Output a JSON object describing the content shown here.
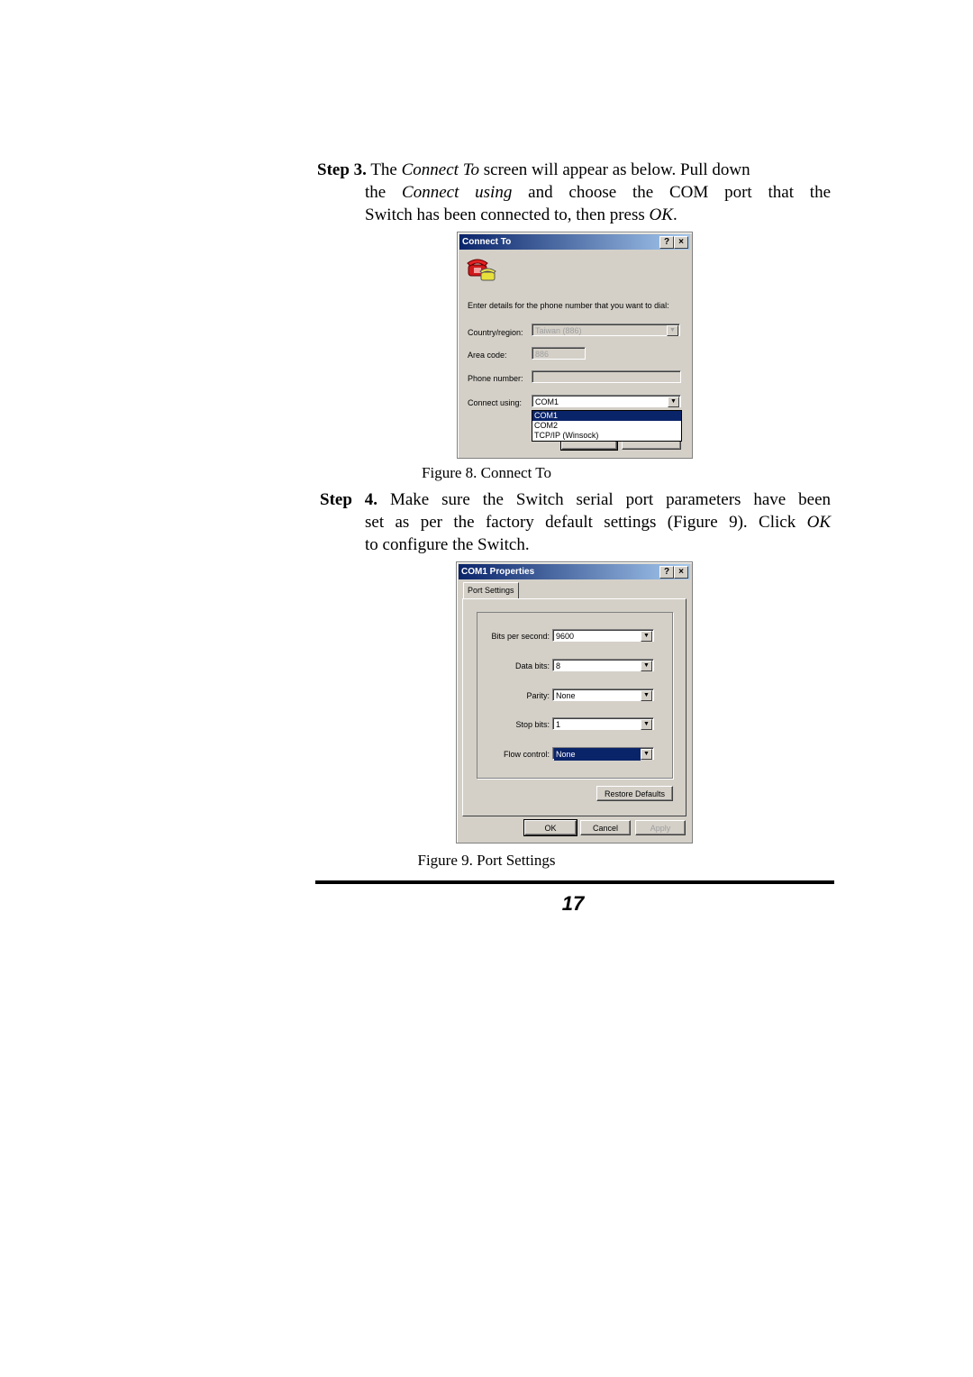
{
  "step3": {
    "label": "Step 3.",
    "line1_pre": "The ",
    "line1_em": "Connect To",
    "line1_post": " screen will appear as below. Pull down",
    "line2_pre": "the ",
    "line2_em": "Connect using",
    "line2_post": " and choose the COM port that the",
    "line3_pre": "Switch has been connected to, then press ",
    "line3_em": "OK",
    "line3_post": "."
  },
  "figure8": {
    "caption": "Figure 8. Connect To",
    "dialog": {
      "title": "Connect To",
      "help_button": "?",
      "close_button": "×",
      "icon": "telephone-icon",
      "prompt": "Enter details for the phone number that you want to dial:",
      "country_label": "Country/region:",
      "country_value": "Taiwan (886)",
      "area_label": "Area code:",
      "area_value": "886",
      "phone_label": "Phone number:",
      "phone_value": "",
      "connect_label": "Connect using:",
      "connect_value": "COM1",
      "connect_options": [
        "COM1",
        "COM2",
        "TCP/IP (Winsock)"
      ],
      "connect_selected": "COM1"
    }
  },
  "step4": {
    "label": "Step 4.",
    "line1": "Make sure the Switch serial port parameters have been",
    "line2_pre": "set as per the factory default settings (Figure 9). Click ",
    "line2_em": "OK",
    "line3": "to configure the Switch."
  },
  "figure9": {
    "caption": "Figure 9. Port Settings",
    "dialog": {
      "title": "COM1 Properties",
      "help_button": "?",
      "close_button": "×",
      "tab": "Port Settings",
      "fields": [
        {
          "label": "Bits per second:",
          "value": "9600"
        },
        {
          "label": "Data bits:",
          "value": "8"
        },
        {
          "label": "Parity:",
          "value": "None"
        },
        {
          "label": "Stop bits:",
          "value": "1"
        },
        {
          "label": "Flow control:",
          "value": "None"
        }
      ],
      "restore_button": "Restore Defaults",
      "ok_button": "OK",
      "cancel_button": "Cancel",
      "apply_button": "Apply"
    }
  },
  "footer": {
    "page_number": "17"
  }
}
